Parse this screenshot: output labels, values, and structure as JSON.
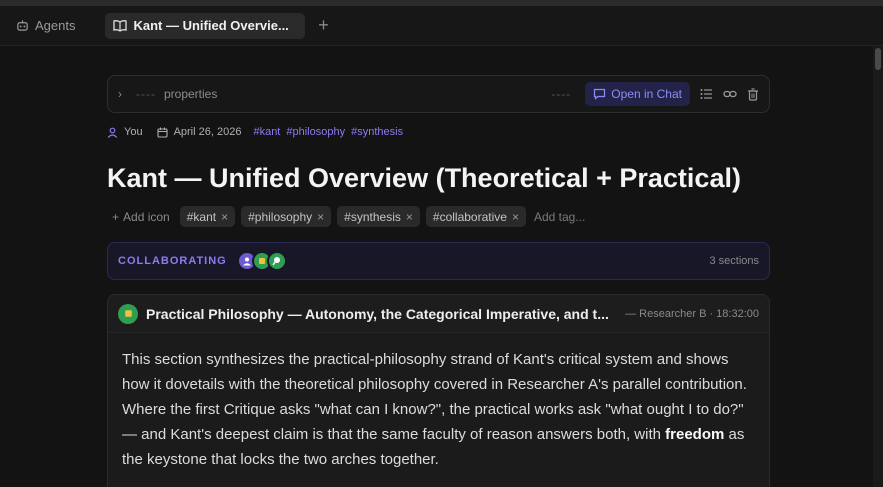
{
  "tabs": {
    "agents_label": "Agents",
    "active_label": "Kant — Unified Overvie...",
    "add_label": "+"
  },
  "properties": {
    "chevron": "›",
    "dash_left": "----",
    "label": "properties",
    "dash_right": "----",
    "open_chat_label": "Open in Chat",
    "icons": [
      "list-icon",
      "link-icon",
      "trash-icon"
    ]
  },
  "meta": {
    "author": "You",
    "date": "April 26, 2026",
    "tags": [
      "#kant",
      "#philosophy",
      "#synthesis"
    ]
  },
  "page": {
    "title": "Kant — Unified Overview (Theoretical + Practical)"
  },
  "tag_row": {
    "add_icon_label": "Add icon",
    "chips": [
      "#kant",
      "#philosophy",
      "#synthesis",
      "#collaborative"
    ],
    "remove_glyph": "×",
    "add_tag_placeholder": "Add tag..."
  },
  "collab": {
    "label": "COLLABORATING",
    "sections_count": "3 sections",
    "avatar_colors": [
      "#6d5bd0",
      "#2f9e52",
      "#2f9e52"
    ]
  },
  "section": {
    "title": "Practical Philosophy — Autonomy, the Categorical Imperative, and t...",
    "byline": "— Researcher B · 18:32:00",
    "body_before": "This section synthesizes the practical-philosophy strand of Kant's critical system and shows how it dovetails with the theoretical philosophy covered in Researcher A's parallel contribution. Where the first Critique asks \"what can I know?\", the practical works ask \"what ought I to do?\" — and Kant's deepest claim is that the same faculty of reason answers both, with ",
    "body_bold": "freedom",
    "body_after": " as the keystone that locks the two arches together."
  },
  "colors": {
    "accent": "#8b7cf0",
    "background": "#131313"
  }
}
